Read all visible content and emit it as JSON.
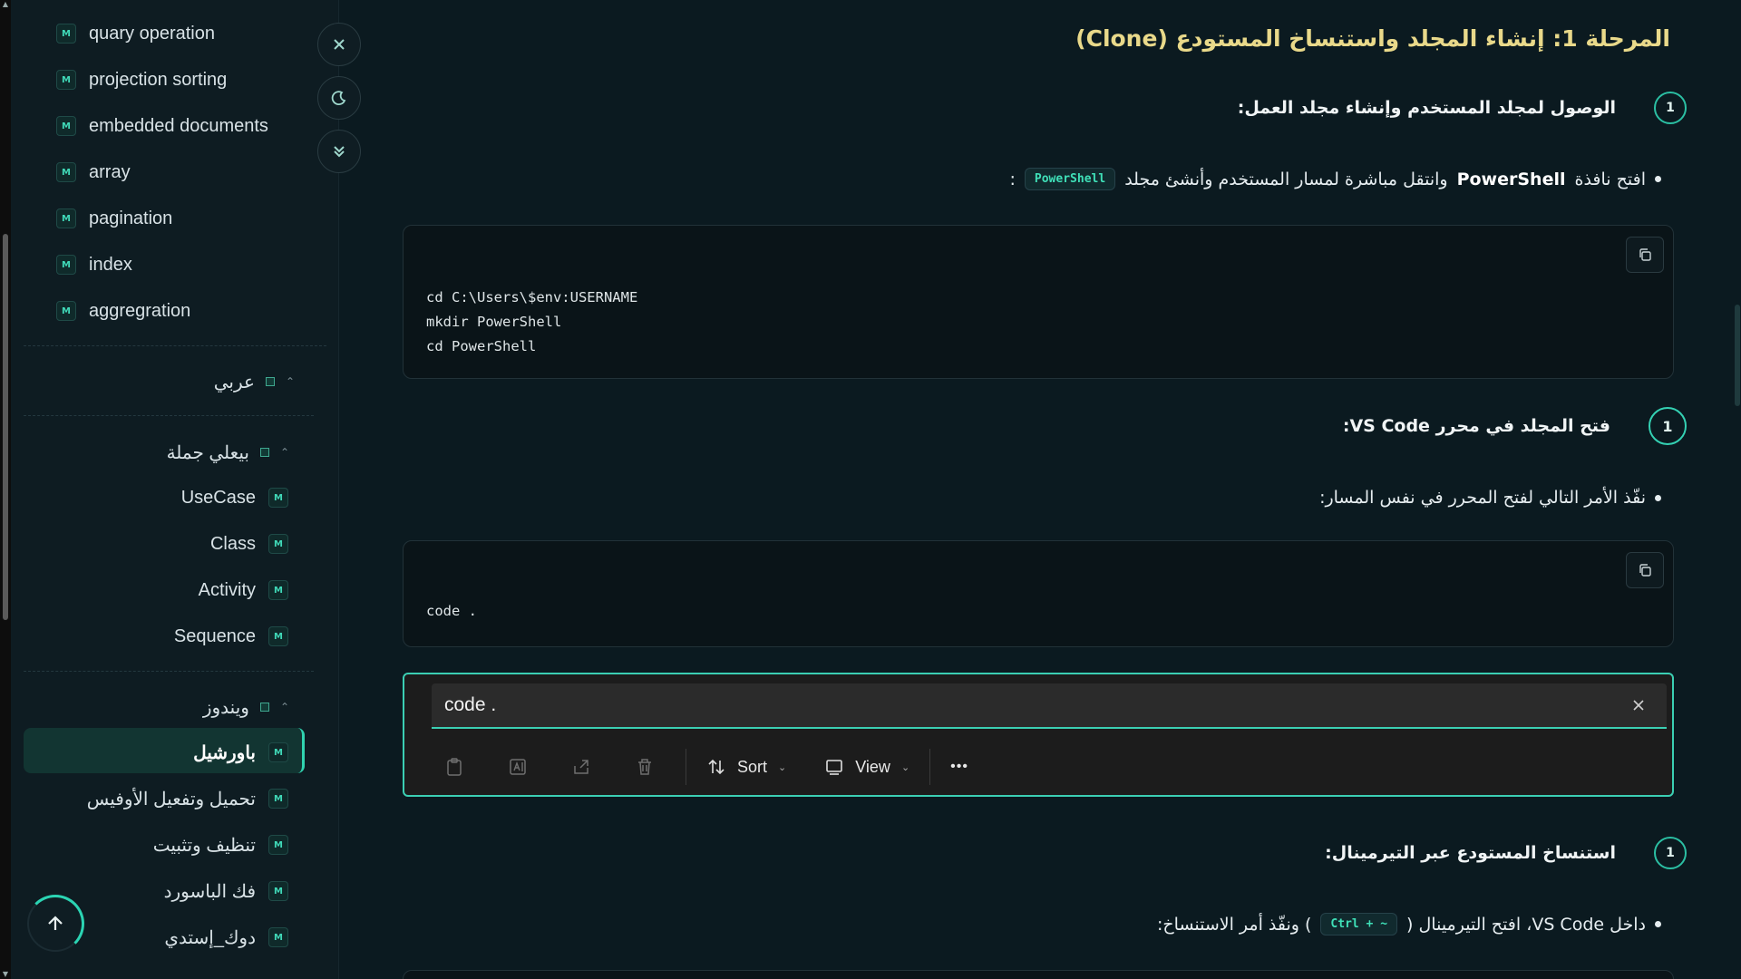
{
  "sidebar": {
    "top_items": [
      {
        "label": "quary operation",
        "badge": "M"
      },
      {
        "label": "projection sorting",
        "badge": "M"
      },
      {
        "label": "embedded documents",
        "badge": "M"
      },
      {
        "label": "array",
        "badge": "M"
      },
      {
        "label": "pagination",
        "badge": "M"
      },
      {
        "label": "index",
        "badge": "M"
      },
      {
        "label": "aggregration",
        "badge": "M"
      }
    ],
    "group_arabic": {
      "label": "عربي"
    },
    "group_jumla": {
      "label": "بيعلي جملة"
    },
    "jumla_items": [
      {
        "label": "UseCase",
        "badge": "M"
      },
      {
        "label": "Class",
        "badge": "M"
      },
      {
        "label": "Activity",
        "badge": "M"
      },
      {
        "label": "Sequence",
        "badge": "M"
      }
    ],
    "group_windows": {
      "label": "ويندوز"
    },
    "windows_items": [
      {
        "label": "باورشيل",
        "badge": "M"
      },
      {
        "label": "تحميل وتفعيل الأوفيس",
        "badge": "M"
      },
      {
        "label": "تنظيف وتثبيت",
        "badge": "M"
      },
      {
        "label": "فك الباسورد",
        "badge": "M"
      },
      {
        "label": "دوك_إستدي",
        "badge": "M"
      }
    ]
  },
  "main": {
    "heading": "المرحلة 1: إنشاء المجلد واستنساخ المستودع (Clone)",
    "step1": {
      "num": "1",
      "title": "الوصول لمجلد المستخدم وإنشاء مجلد العمل:",
      "bullet_pre": "افتح نافذة",
      "bullet_bold": "PowerShell",
      "bullet_post": "وانتقل مباشرة لمسار المستخدم وأنشئ مجلد",
      "chip": "PowerShell",
      "bullet_end": ":",
      "code": "cd C:\\Users\\$env:USERNAME\nmkdir PowerShell\ncd PowerShell"
    },
    "step2": {
      "num": "1",
      "title": "فتح المجلد في محرر VS Code:",
      "bullet": "نفّذ الأمر التالي لفتح المحرر في نفس المسار:",
      "code": "code ."
    },
    "step3": {
      "num": "1",
      "title": "استنساخ المستودع عبر التيرمينال:",
      "bullet_pre": "داخل VS Code، افتح التيرمينال (",
      "chip": "Ctrl + ~",
      "bullet_post": ") ونفّذ أمر الاستنساخ:"
    }
  },
  "findbar": {
    "value": "code .",
    "sort_label": "Sort",
    "view_label": "View",
    "more_label": "•••"
  },
  "colors": {
    "accent": "#3bcfb3",
    "heading": "#e9d98a",
    "background": "#0b1a20"
  }
}
